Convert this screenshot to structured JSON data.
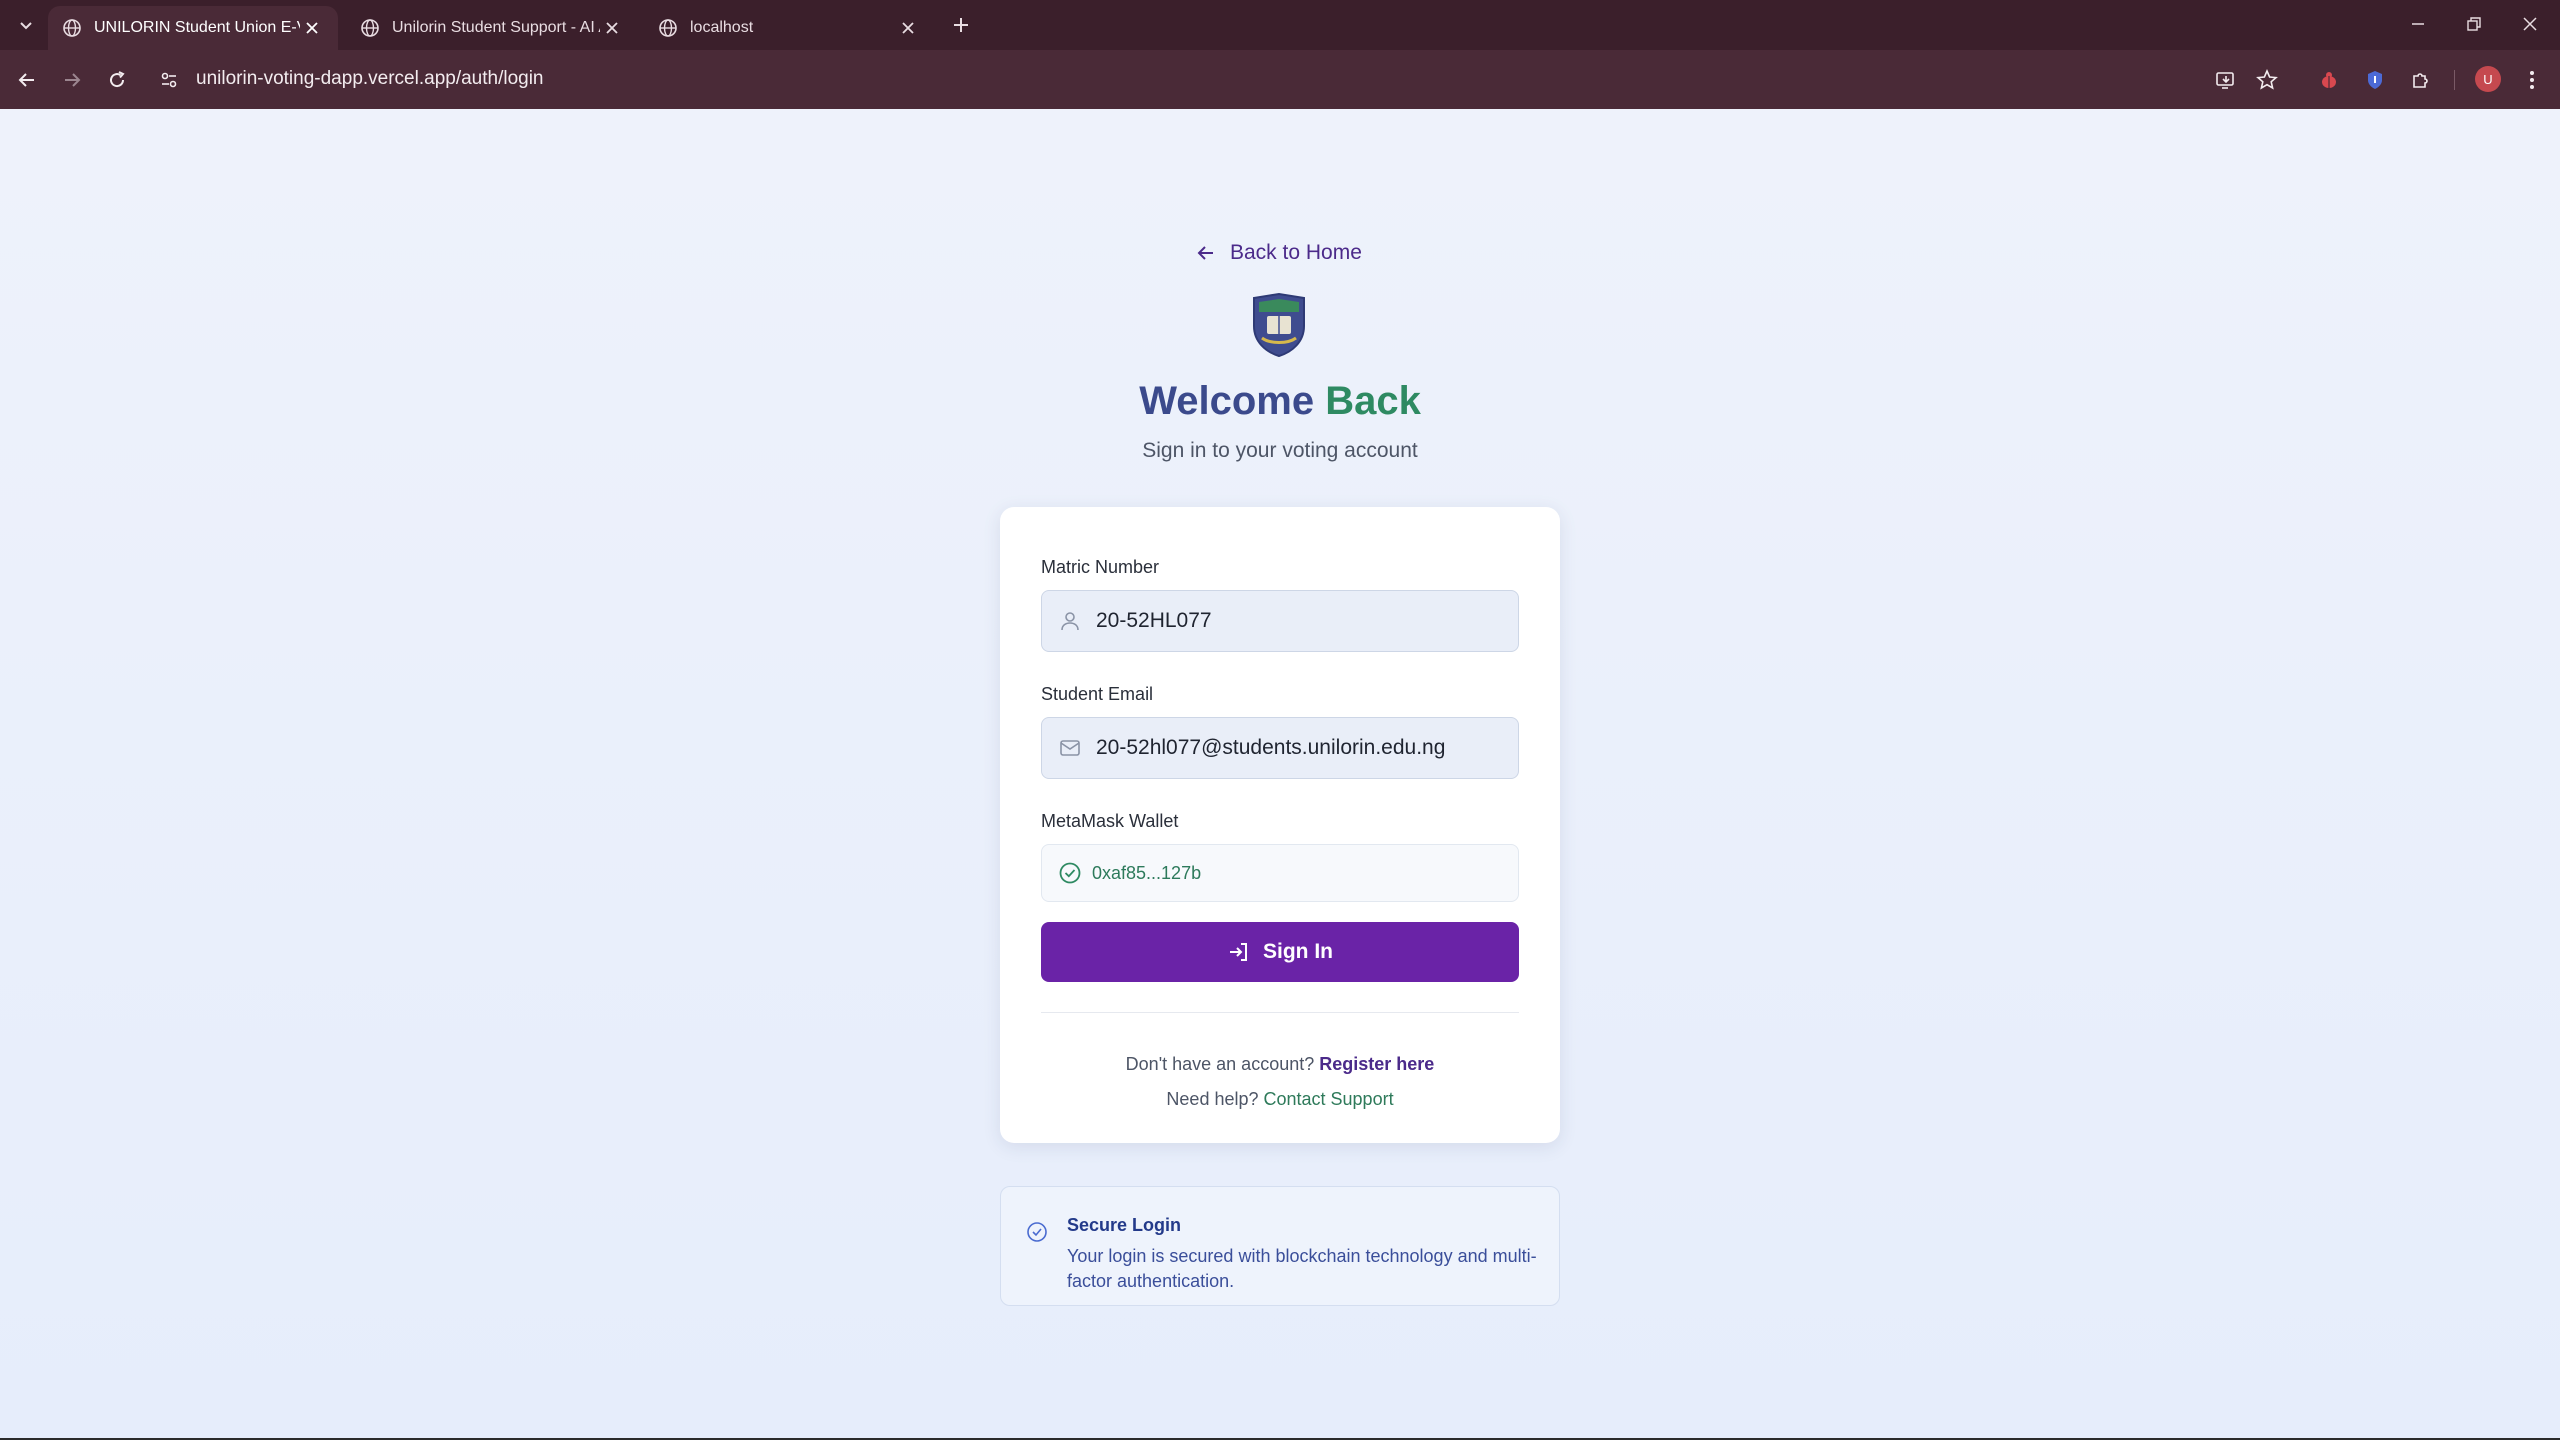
{
  "browser": {
    "tabs": [
      {
        "title": "UNILORIN Student Union E-Voti",
        "active": true
      },
      {
        "title": "Unilorin Student Support - AI A",
        "active": false
      },
      {
        "title": "localhost",
        "active": false
      }
    ],
    "url": "unilorin-voting-dapp.vercel.app/auth/login",
    "avatar_initial": "U"
  },
  "page": {
    "back_label": "Back to Home",
    "title_part1": "Welcome ",
    "title_part2": "Back",
    "subtitle": "Sign in to your voting account"
  },
  "form": {
    "matric_label": "Matric Number",
    "matric_value": "20-52HL077",
    "email_label": "Student Email",
    "email_value": "20-52hl077@students.unilorin.edu.ng",
    "wallet_label": "MetaMask Wallet",
    "wallet_value": "0xaf85...127b",
    "signin_label": "Sign In",
    "no_account_text": "Don't have an account? ",
    "register_label": "Register here",
    "help_text": "Need help? ",
    "support_label": "Contact Support"
  },
  "secure": {
    "title": "Secure Login",
    "text": "Your login is secured with blockchain technology and multi-factor authentication."
  },
  "colors": {
    "accent": "#6a23a7",
    "title_blue": "#3b4a8c",
    "title_green": "#2e8a62",
    "chrome": "#4a2a37"
  }
}
